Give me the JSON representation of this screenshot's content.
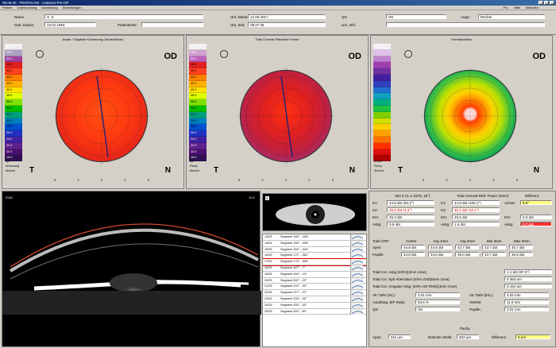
{
  "window": {
    "title": "09.08.00 - PENTACAM - Cataract Pre-OP"
  },
  "menu": [
    "Patient",
    "Untersuchung",
    "Darstellung",
    "Einstellungen"
  ],
  "menu_right": [
    "Pro",
    "Hilfe",
    "Beenden"
  ],
  "patient": {
    "name_label": "Name",
    "name": "X, X",
    "dob_label": "Geb. Datum:",
    "dob": "23.01.1954",
    "pid_label": "PatientenID:",
    "pid": "",
    "date_label": "Unt. Datum:",
    "date": "12.06.2017",
    "time_label": "Unt. Zeit:",
    "time": "09:27:45",
    "info_label": "Unt. Info:",
    "info": "",
    "qs_label": "QS:",
    "qs": "OK",
    "eye_label": "Auge:",
    "eye": "Rechts"
  },
  "maps": [
    {
      "title": "Axiale / Sagittale Krümmung (Vorderfläche)",
      "eye": "OD",
      "left": "T",
      "right": "N",
      "unit": "dpt",
      "scale_label": "Krümmung",
      "scale_sub": "Absolut",
      "scale": [
        "80.0",
        "76.0",
        "50.0",
        "48.0",
        "46.0",
        "44.0",
        "42.0",
        "40.0",
        "38.0",
        "36.0",
        "34.0",
        "32.0",
        "30.0",
        "28.0",
        "26.0",
        "24.0",
        "22.0",
        "20.0",
        "18.0"
      ],
      "colors": [
        "#f0f0f0",
        "#b0a0c0",
        "#a040a0",
        "#e02020",
        "#ff4020",
        "#ff8000",
        "#ffb000",
        "#ffe000",
        "#e0ff00",
        "#80e000",
        "#00c000",
        "#00a080",
        "#0080c0",
        "#0050d0",
        "#2030c0",
        "#4020a0",
        "#60208a",
        "#4a1070",
        "#301050"
      ],
      "axes": [
        "0",
        "4",
        "8"
      ]
    },
    {
      "title": "Total Corneal Refractive Power",
      "eye": "OD",
      "left": "T",
      "right": "N",
      "unit": "dpt",
      "scale_label": "Pachy",
      "scale_sub": "Absolut",
      "scale": [
        "80.0",
        "76.0",
        "50.0",
        "48.0",
        "46.0",
        "44.0",
        "42.0",
        "40.0",
        "38.0",
        "36.0",
        "34.0",
        "32.0",
        "30.0",
        "28.0",
        "26.0",
        "24.0",
        "22.0",
        "20.0",
        "18.0"
      ],
      "colors": [
        "#f0f0f0",
        "#d0a0d0",
        "#c060c0",
        "#e02020",
        "#ff4020",
        "#ff8000",
        "#ffb000",
        "#ffe000",
        "#e0ff00",
        "#80e000",
        "#00c000",
        "#00a080",
        "#0080c0",
        "#0050d0",
        "#2030c0",
        "#4020a0",
        "#60208a",
        "#4a1070",
        "#301050"
      ],
      "axes": [
        "0",
        "4",
        "8"
      ]
    },
    {
      "title": "Hornhautdicke",
      "eye": "OD",
      "left": "T",
      "right": "N",
      "unit": "10 µm",
      "scale_label": "Pachy",
      "scale_sub": "Absolut",
      "scale": [
        "",
        "",
        "",
        "",
        "",
        "",
        "",
        "",
        "",
        "",
        "",
        "",
        "",
        "",
        "",
        "",
        "",
        "",
        ""
      ],
      "colors": [
        "#f4f0f8",
        "#e0c0e8",
        "#c080d0",
        "#a040b0",
        "#7030a0",
        "#4020a0",
        "#3040c0",
        "#2070d0",
        "#10a0c0",
        "#00b080",
        "#20c040",
        "#80d000",
        "#d0e000",
        "#ffd000",
        "#ffa000",
        "#ff7000",
        "#ff3000",
        "#e01010",
        "#b00000"
      ],
      "axes": [
        "0",
        "4",
        "8"
      ]
    }
  ],
  "scheimpflug": {
    "top_left": "IC&C",
    "top_right": "10:1"
  },
  "eyeimg": {
    "label": "B"
  },
  "segments": [
    {
      "n": "13/25",
      "t": "Segment 148° - 328°"
    },
    {
      "n": "14/25",
      "t": "Segment 156° - 336°"
    },
    {
      "n": "15/25",
      "t": "Segment 164° - 344°"
    },
    {
      "n": "16/25",
      "t": "Segment 171° - 351°"
    },
    {
      "n": "17/25",
      "t": "Segment 179° - 359°",
      "sel": true
    },
    {
      "n": "18/25",
      "t": "Segment 187° - 7°"
    },
    {
      "n": "19/25",
      "t": "Segment 194° - 14°"
    },
    {
      "n": "20/25",
      "t": "Segment 202° - 22°"
    },
    {
      "n": "21/25",
      "t": "Segment 210° - 30°"
    },
    {
      "n": "22/25",
      "t": "Segment 217° - 37°"
    },
    {
      "n": "23/25",
      "t": "Segment 225° - 45°"
    },
    {
      "n": "24/25",
      "t": "Segment 233° - 53°"
    },
    {
      "n": "25/25",
      "t": "Segment 240° - 60°"
    }
  ],
  "table": {
    "h1": "Sim K (n=1.3375, 15°)",
    "h2": "Total Corneal Refr. Power (4mm)",
    "h3": "Differenz",
    "rows": [
      {
        "l": "K1:",
        "a": "44.9 dpt (94.3°)",
        "l2": "K1:",
        "b": "44.9 dpt (100.1°)",
        "l3": "Achse:",
        "c": "5.6°"
      },
      {
        "l": "K2:",
        "a": "45.8 dpt (4.3°)",
        "l2": "K2:",
        "b": "46.1 dpt (10.1°)",
        "l3": "",
        "c": ""
      },
      {
        "l": "Km:",
        "a": "45.3 dpt",
        "l2": "Km:",
        "b": "45.5 dpt",
        "l3": "Km:",
        "c": "0.0 dpt"
      },
      {
        "l": "Astig:",
        "a": "0.9 dpt",
        "l2": "Astig:",
        "b": "1.6 dpt",
        "l3": "Astig:",
        "c": "0.7 dpt"
      }
    ],
    "crp_h": [
      "Total CRP:",
      "Centre",
      "Avg 1mm",
      "Avg 3mm",
      "Min 3mm",
      "Max 3mm"
    ],
    "crp": [
      {
        "l": "Apex:",
        "v": [
          "44.8 dpt",
          "44.6 dpt",
          "43.7 dpt",
          "43.7 dpt",
          "45.7 dpt"
        ]
      },
      {
        "l": "Pupille:",
        "v": [
          "44.8 dpt",
          "44.6 dpt",
          "45.0 dpt",
          "43.7 dpt",
          "45.8 dpt"
        ]
      }
    ],
    "misc": [
      {
        "l": "Total Cor. Astig (tcRA)(4mm zone)",
        "v": "1.1 dpt (87.3°)"
      },
      {
        "l": "Total Cor. Sph Aberration (tcRA Z40)(6mm zone)",
        "v": "0.353 µm"
      },
      {
        "l": "Total Cor. Irregular Astig. (tcRA HO RMS)(4mm zone)",
        "v": "0.154 µm"
      }
    ],
    "vk_l": "VK Tiefe (Int.):",
    "vk": "3.01 mm",
    "vke_l": "VK Tiefe (Ext.):",
    "vke": "4.02 mm",
    "ratio_l": "Axial/Sag. B/F Ratio:",
    "ratio": "83.6 %",
    "hvid_l": "HWzW:",
    "hvid": "11.9 mm",
    "qs_l": "QS:",
    "qs": "OK",
    "pup_l": "Pupille:",
    "pup": "3.01 mm",
    "pachy_h": "Pachy",
    "pachy": [
      {
        "l": "Apex:",
        "v": "511 µm"
      },
      {
        "l": "Dünnste Stelle:",
        "v": "503 µm"
      },
      {
        "l": "Differenz:",
        "v": "8 µm"
      }
    ]
  }
}
